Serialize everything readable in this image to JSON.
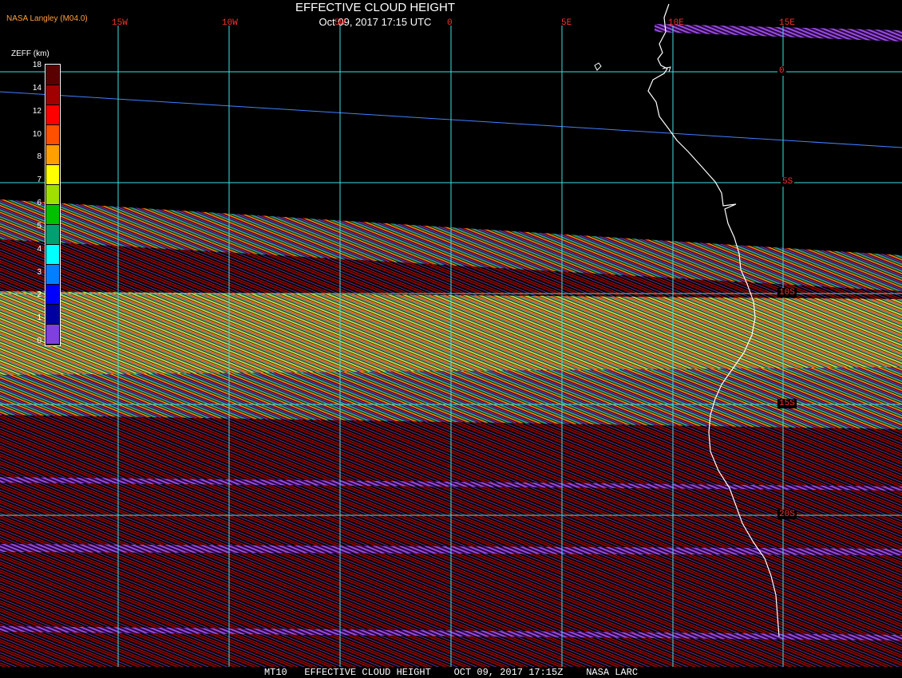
{
  "header": {
    "title": "EFFECTIVE CLOUD HEIGHT",
    "datetime": "Oct 09, 2017 17:15 UTC",
    "credit": "NASA Langley (M04.0)"
  },
  "grid": {
    "lon_labels": [
      "15W",
      "10W",
      "5W",
      "0",
      "5E",
      "10E",
      "15E"
    ],
    "lat_labels": [
      "0",
      "5S",
      "10S",
      "15S",
      "20S"
    ]
  },
  "colorbar": {
    "title": "ZEFF (km)",
    "ticks": [
      "18",
      "14",
      "12",
      "10",
      "8",
      "7",
      "6",
      "5",
      "4",
      "3",
      "2",
      "1",
      "0"
    ],
    "colors": [
      "#5a0000",
      "#a00000",
      "#ff0000",
      "#ff5000",
      "#ffa000",
      "#ffff00",
      "#a0e000",
      "#00c000",
      "#00a070",
      "#00ffff",
      "#0080ff",
      "#0000ff",
      "#0000a0",
      "#8040e0"
    ]
  },
  "footer": {
    "text": "MT10   EFFECTIVE CLOUD HEIGHT    OCT 09, 2017 17:15Z    NASA LARC"
  },
  "colors": {
    "gridline": "#40e0e0",
    "coastline": "#ffffff",
    "label": "#ff3030",
    "equator_line": "#4080ff"
  }
}
